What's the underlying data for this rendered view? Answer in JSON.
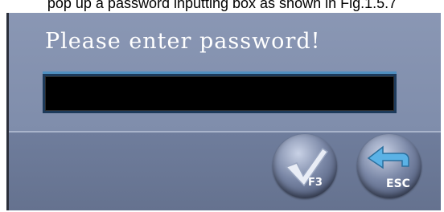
{
  "caption": "pop up a password inputting box as shown in Fig.1.5.7",
  "dialog": {
    "prompt": "Please enter password!",
    "password_value": ""
  },
  "buttons": {
    "ok_key": "F3",
    "ok_icon": "checkmark-icon",
    "esc_key": "ESC",
    "esc_icon": "return-arrow-icon"
  },
  "colors": {
    "dialog_bg": "#7c8aa8",
    "input_bg": "#000000",
    "input_border_accent": "#4f8fc0"
  }
}
